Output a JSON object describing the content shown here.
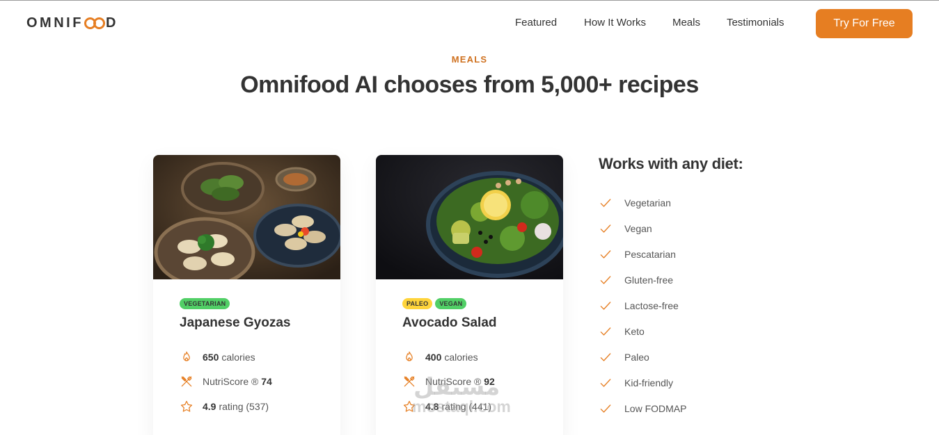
{
  "header": {
    "logo": {
      "left": "OMNIF",
      "right": "D"
    },
    "nav": [
      "Featured",
      "How It Works",
      "Meals",
      "Testimonials"
    ],
    "cta": "Try For Free"
  },
  "section": {
    "label": "MEALS",
    "title": "Omnifood AI chooses from 5,000+ recipes"
  },
  "meals": [
    {
      "tags": [
        "VEGETARIAN"
      ],
      "title": "Japanese Gyozas",
      "calories_value": "650",
      "calories_unit": "calories",
      "nutri_label": "NutriScore ®",
      "nutri_value": "74",
      "rating_value": "4.9",
      "rating_label": "rating (537)"
    },
    {
      "tags": [
        "PALEO",
        "VEGAN"
      ],
      "title": "Avocado Salad",
      "calories_value": "400",
      "calories_unit": "calories",
      "nutri_label": "NutriScore ®",
      "nutri_value": "92",
      "rating_value": "4.8",
      "rating_label": "rating (441)"
    }
  ],
  "diet": {
    "title": "Works with any diet:",
    "items": [
      "Vegetarian",
      "Vegan",
      "Pescatarian",
      "Gluten-free",
      "Lactose-free",
      "Keto",
      "Paleo",
      "Kid-friendly",
      "Low FODMAP"
    ]
  },
  "watermark": {
    "arabic": "مستقل",
    "latin": "mostaql.com"
  },
  "colors": {
    "accent": "#e67e22",
    "accent_dark": "#cf711f",
    "tag_green": "#51cf66",
    "tag_yellow": "#ffd43b",
    "text": "#333333"
  },
  "icons": [
    "flame-icon",
    "utensils-icon",
    "star-icon",
    "checkmark-icon"
  ]
}
